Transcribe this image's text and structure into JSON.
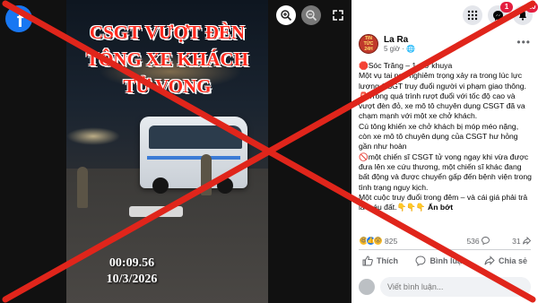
{
  "viewer": {
    "photo_title_lines": [
      "CSGT VƯỢT ĐÈN",
      "TÔNG XE KHÁCH",
      "TỬ VONG"
    ],
    "timestamp_time": "00:09.56",
    "timestamp_date": "10/3/2026",
    "zoom_in_icon": "zoom-in-icon",
    "zoom_out_icon": "zoom-out-icon",
    "fullscreen_icon": "fullscreen-icon"
  },
  "topbar": {
    "menu_icon": "grid-menu-icon",
    "messenger_badge": "1",
    "notifications_badge": "10"
  },
  "post": {
    "author": "La Ra",
    "time": "5 giờ · 🌐",
    "avatar_text": "TIN TỨC 24H",
    "paragraphs": [
      "🛑Sóc Trăng – 1 giờ khuya",
      "Một vụ tai nạn nghiêm trọng xảy ra trong lúc lực lượng CSGT truy đuổi người vi phạm giao thông.",
      "🚨Trong quá trình rượt đuổi với tốc độ cao và vượt đèn đỏ, xe mô tô chuyên dụng CSGT đã va chạm mạnh với một xe chở khách.",
      "Cú tông khiến xe chở khách bị móp méo nặng, còn xe mô tô chuyên dụng của CSGT hư hỏng gần như hoàn",
      "🚫một chiến sĩ CSGT tử vong ngay khi vừa được đưa lên xe cứu thương, một chiến sĩ khác đang bất động và được chuyển gấp đến bệnh viện trong tình trạng nguy kịch.",
      "Một cuộc truy đuổi trong đêm – và cái giá phải trả là máu đất.👇👇👇"
    ],
    "see_more": "Ẩn bớt",
    "reactions_count": "825",
    "comments_count": "536",
    "shares_count": "31",
    "actions": {
      "like": "Thích",
      "comment": "Bình luận",
      "share": "Chia sẻ"
    },
    "comment_placeholder": "Viết bình luận..."
  },
  "colors": {
    "accent": "#1877f2",
    "cross": "#e0251b",
    "title": "#ff2b1f"
  }
}
